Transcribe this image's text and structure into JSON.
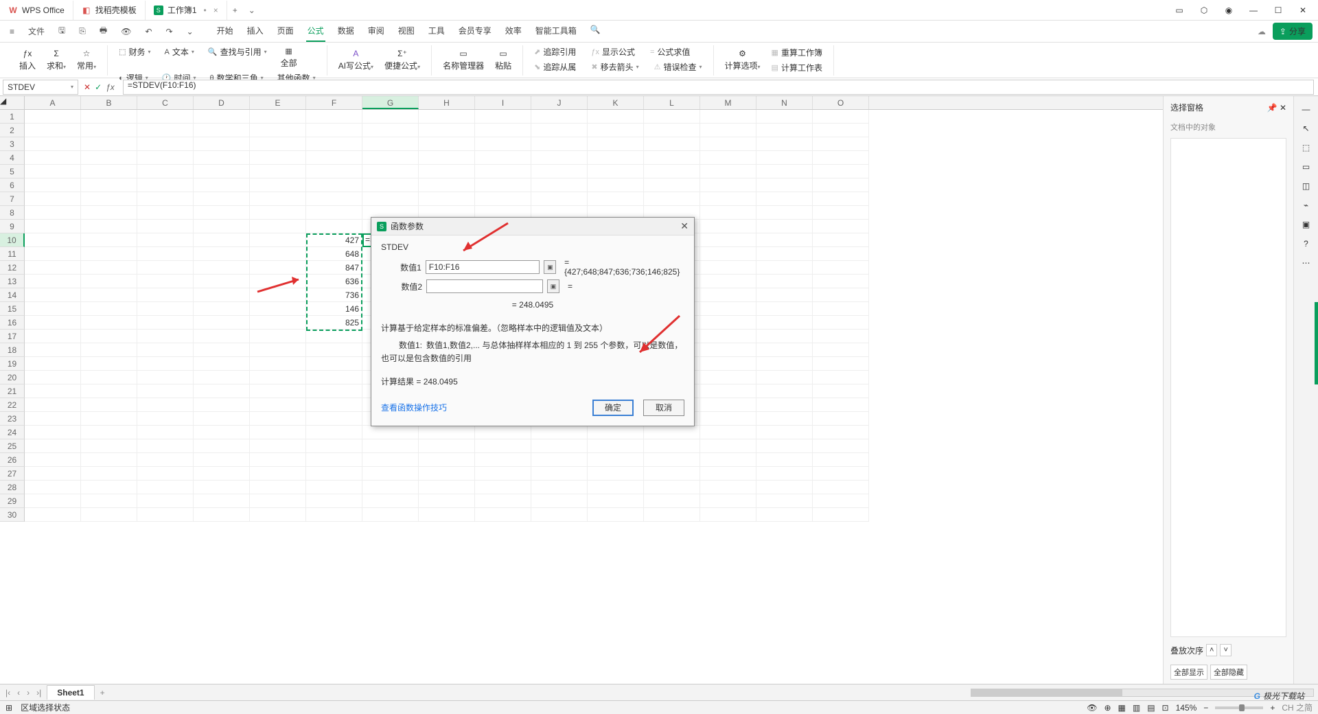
{
  "titlebar": {
    "tabs": [
      {
        "icon": "wps",
        "label": "WPS Office"
      },
      {
        "icon": "tpl",
        "label": "找稻壳模板"
      },
      {
        "icon": "sheet",
        "label": "工作簿1",
        "active": true,
        "dirty": "•"
      }
    ],
    "add": "+"
  },
  "menubar": {
    "file": "文件",
    "tabs": [
      "开始",
      "插入",
      "页面",
      "公式",
      "数据",
      "审阅",
      "视图",
      "工具",
      "会员专享",
      "效率",
      "智能工具箱"
    ],
    "active": "公式",
    "share": "分享"
  },
  "ribbon": {
    "g1": {
      "insert": "插入",
      "sum": "求和",
      "common": "常用"
    },
    "g2": {
      "fin": "财务",
      "text": "文本",
      "lookup": "查找与引用",
      "all": "全部",
      "logic": "逻辑",
      "time": "时间",
      "math": "数学和三角",
      "other": "其他函数"
    },
    "g3": {
      "ai": "AI写公式",
      "quick": "便捷公式"
    },
    "g4": {
      "name": "名称管理器",
      "paste": "粘贴",
      "trace": "追踪引用",
      "show": "显示公式",
      "calc": "公式求值",
      "dep": "追踪从属",
      "arrow": "移去箭头",
      "err": "错误检查"
    },
    "g5": {
      "opt": "计算选项",
      "recalc": "重算工作簿",
      "recalcsheet": "计算工作表"
    }
  },
  "formula": {
    "name": "STDEV",
    "input": "=STDEV(F10:F16)"
  },
  "columns": [
    "A",
    "B",
    "C",
    "D",
    "E",
    "F",
    "G",
    "H",
    "I",
    "J",
    "K",
    "L",
    "M",
    "N",
    "O"
  ],
  "sel_col": "G",
  "sel_row": 10,
  "data_values": [
    "427",
    "648",
    "847",
    "636",
    "736",
    "146",
    "825"
  ],
  "active_cell_text": "=S",
  "dialog": {
    "title": "函数参数",
    "fn": "STDEV",
    "p1_label": "数值1",
    "p1_value": "F10:F16",
    "p1_eval": "= {427;648;847;636;736;146;825}",
    "p2_label": "数值2",
    "p2_value": "",
    "p2_eval": "=",
    "mid_result": "= 248.0495",
    "desc_main": "计算基于给定样本的标准偏差。（忽略样本中的逻辑值及文本）",
    "desc_p_label": "数值1:",
    "desc_p_text": "数值1,数值2,... 与总体抽样样本相应的 1 到 255 个参数，可以是数值，也可以是包含数值的引用",
    "result_label": "计算结果 =",
    "result_value": "248.0495",
    "link": "查看函数操作技巧",
    "ok": "确定",
    "cancel": "取消"
  },
  "sidepanel": {
    "title": "选择窗格",
    "objects": "文档中的对象",
    "order": "叠放次序",
    "showall": "全部显示",
    "hideall": "全部隐藏"
  },
  "sheettabs": {
    "sheet": "Sheet1"
  },
  "statusbar": {
    "mode": "区域选择状态",
    "zoom": "145%",
    "ime": "CH 之简"
  },
  "watermark": "极光下载站"
}
